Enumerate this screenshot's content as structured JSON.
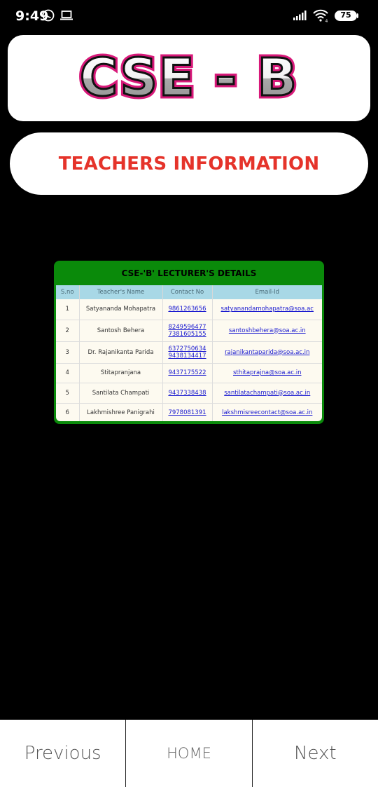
{
  "status": {
    "time": "9:49",
    "battery": "75"
  },
  "header": {
    "title": "CSE - B"
  },
  "subtitle": "TEACHERS INFORMATION",
  "table": {
    "title": "CSE-'B' LECTURER'S DETAILS",
    "columns": [
      "S.no",
      "Teacher's Name",
      "Contact No",
      "Email-Id"
    ],
    "rows": [
      {
        "sno": "1",
        "name": "Satyananda Mohapatra",
        "phones": [
          "9861263656"
        ],
        "email": "satyanandamohapatra@soa.ac"
      },
      {
        "sno": "2",
        "name": "Santosh Behera",
        "phones": [
          "8249596477",
          "7381605155"
        ],
        "email": "santoshbehera@soa.ac.in"
      },
      {
        "sno": "3",
        "name": "Dr. Rajanikanta Parida",
        "phones": [
          "6372750634",
          "9438134417"
        ],
        "email": "rajanikantaparida@soa.ac.in"
      },
      {
        "sno": "4",
        "name": "Stitapranjana",
        "phones": [
          "9437175522"
        ],
        "email": "sthitaprajna@soa.ac.in"
      },
      {
        "sno": "5",
        "name": "Santilata Champati",
        "phones": [
          "9437338438"
        ],
        "email": "santilatachampati@soa.ac.in"
      },
      {
        "sno": "6",
        "name": "Lakhmishree Panigrahi",
        "phones": [
          "7978081391"
        ],
        "email": "lakshmisreecontact@soa.ac.in"
      }
    ]
  },
  "nav": {
    "previous": "Previous",
    "home": "HOME",
    "next": "Next"
  },
  "colors": {
    "table_header_bg": "#0a8a0a",
    "subtitle_color": "#e5332a",
    "column_header_bg": "#a8d8e6",
    "link_color": "#1a1ad0"
  }
}
